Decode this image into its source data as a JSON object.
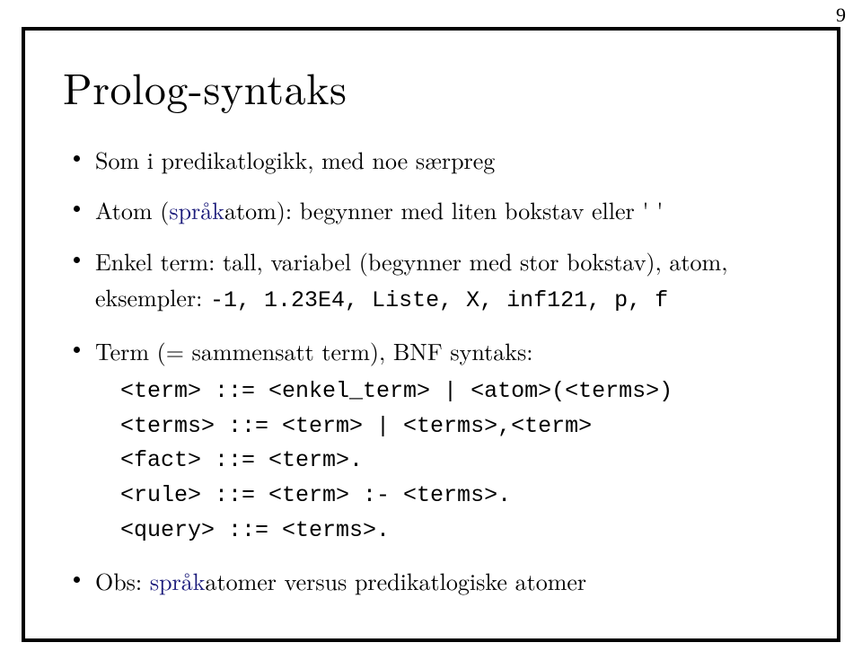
{
  "page_number": "9",
  "title": "Prolog-syntaks",
  "bullets": {
    "b1": "Som i predikatlogikk, med noe særpreg",
    "b2_pre": "Atom (",
    "b2_lang": "språk",
    "b2_post": "atom): begynner med liten bokstav eller ' '",
    "b3_text": "Enkel term: tall, variabel (begynner med stor bokstav), atom, eksempler: ",
    "b3_code": "-1, 1.23E4, Liste, X, inf121, p, f",
    "b4": "Term (= sammensatt term), BNF syntaks:",
    "b5_pre": "Obs: ",
    "b5_lang": "språk",
    "b5_post": "atomer versus predikatlogiske atomer"
  },
  "bnf": {
    "l1": "<term> ::= <enkel_term> | <atom>(<terms>)",
    "l2": "<terms> ::= <term> | <terms>,<term>",
    "l3": "<fact> ::= <term>.",
    "l4": "<rule> ::= <term> :- <terms>.",
    "l5": "<query> ::= <terms>."
  }
}
